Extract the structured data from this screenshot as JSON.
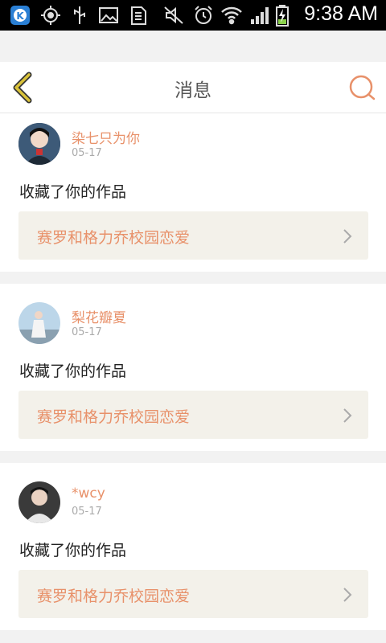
{
  "status_bar": {
    "time": "9:38 AM",
    "icons": [
      "k-app-icon",
      "gps-icon",
      "usb-icon",
      "image-icon",
      "sim-icon",
      "mute-icon",
      "alarm-icon",
      "wifi-icon",
      "signal-icon",
      "battery-charging-icon"
    ]
  },
  "header": {
    "title": "消息",
    "back_icon": "chevron-left-icon",
    "search_icon": "search-icon"
  },
  "colors": {
    "accent": "#e8916a",
    "back": "#d9c23a",
    "card_link_bg": "#f3f1ea"
  },
  "messages": [
    {
      "user": "染七只为你",
      "date": "05-17",
      "action": "收藏了你的作品",
      "work_title": "赛罗和格力乔校园恋爱"
    },
    {
      "user": "梨花瓣夏",
      "date": "05-17",
      "action": "收藏了你的作品",
      "work_title": "赛罗和格力乔校园恋爱"
    },
    {
      "user": "*wcy",
      "date": "05-17",
      "action": "收藏了你的作品",
      "work_title": "赛罗和格力乔校园恋爱"
    }
  ]
}
